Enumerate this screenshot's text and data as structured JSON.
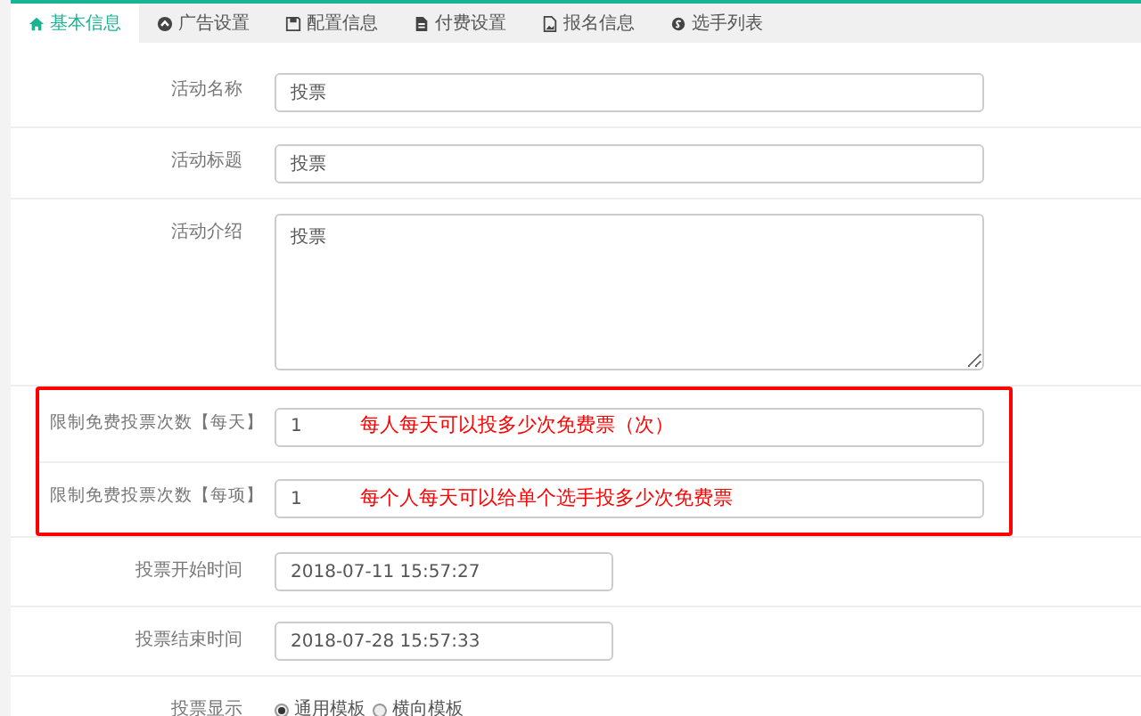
{
  "tabs": [
    {
      "label": "基本信息",
      "selected": true
    },
    {
      "label": "广告设置",
      "selected": false
    },
    {
      "label": "配置信息",
      "selected": false
    },
    {
      "label": "付费设置",
      "selected": false
    },
    {
      "label": "报名信息",
      "selected": false
    },
    {
      "label": "选手列表",
      "selected": false
    }
  ],
  "fields": [
    {
      "kind": "text",
      "label": "活动名称",
      "value": "投票",
      "highlighted": false
    },
    {
      "kind": "text",
      "label": "活动标题",
      "value": "投票",
      "highlighted": false
    },
    {
      "kind": "textarea",
      "label": "活动介绍",
      "value": "投票",
      "highlighted": false
    },
    {
      "kind": "text",
      "label": "限制免费投票次数【每天】",
      "value": "1",
      "annotation": "每人每天可以投多少次免费票（次）",
      "highlighted": true
    },
    {
      "kind": "text",
      "label": "限制免费投票次数【每项】",
      "value": "1",
      "annotation": "每个人每天可以给单个选手投多少次免费票",
      "highlighted": true
    },
    {
      "kind": "date",
      "label": "投票开始时间",
      "value": "2018-07-11 15:57:27",
      "highlighted": false
    },
    {
      "kind": "date",
      "label": "投票结束时间",
      "value": "2018-07-28 15:57:33",
      "highlighted": false
    },
    {
      "kind": "radio",
      "label": "投票显示",
      "options": [
        {
          "label": "通用模板",
          "selected": true
        },
        {
          "label": "横向模板",
          "selected": false
        }
      ],
      "highlighted": false
    }
  ]
}
